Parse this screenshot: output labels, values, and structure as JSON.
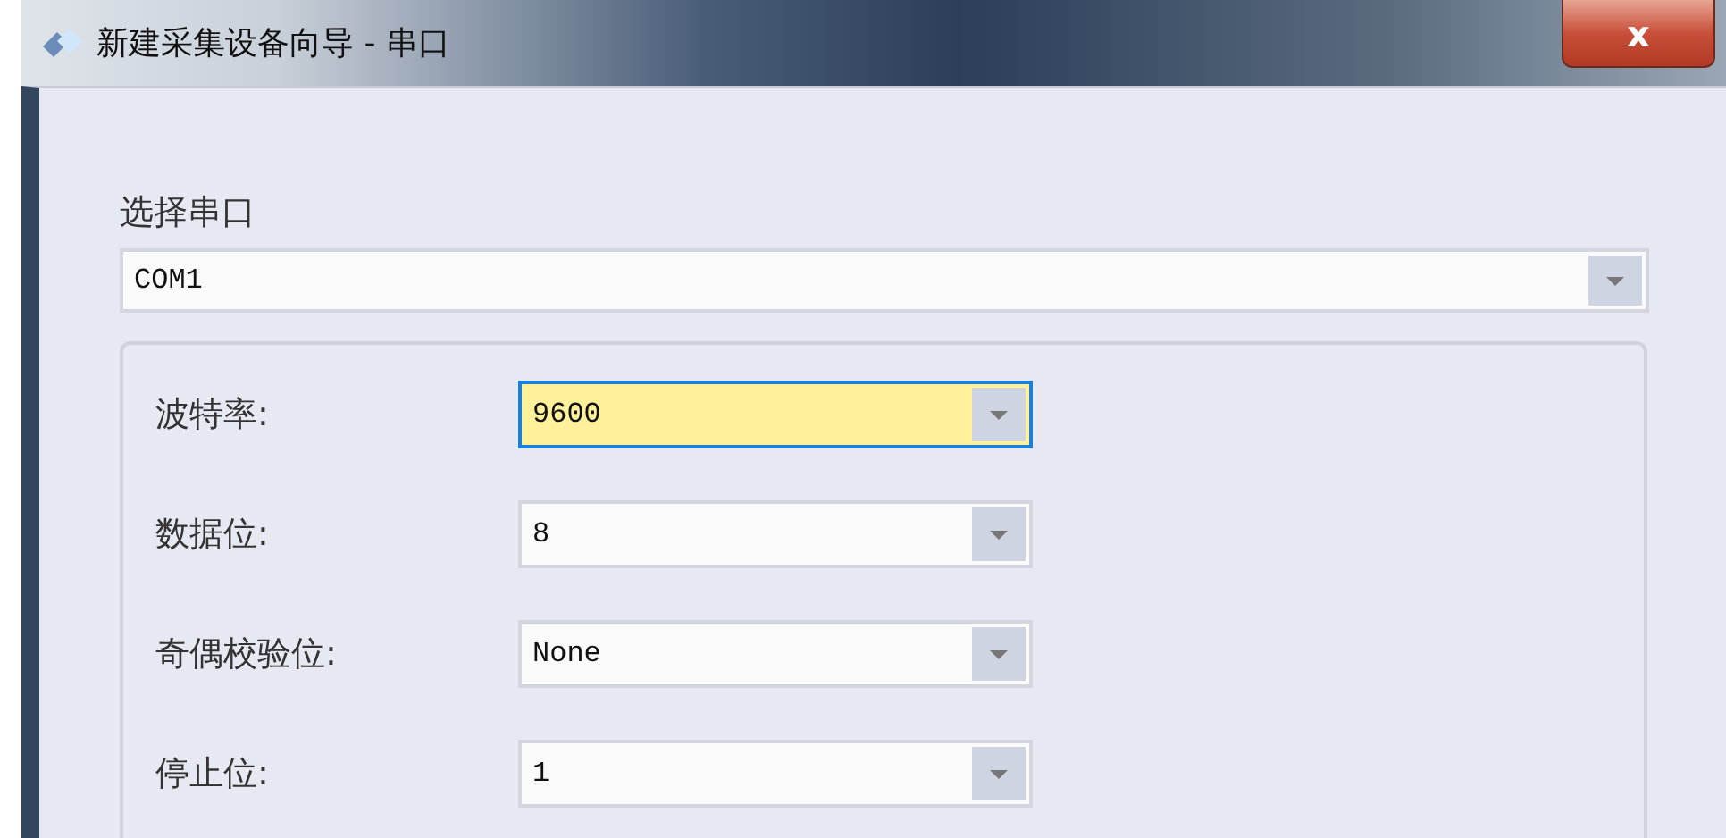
{
  "window": {
    "title": "新建采集设备向导 - 串口",
    "close": "x"
  },
  "port": {
    "label": "选择串口",
    "value": "COM1"
  },
  "settings": [
    {
      "label": "波特率:",
      "value": "9600",
      "focused": true
    },
    {
      "label": "数据位:",
      "value": "8",
      "focused": false
    },
    {
      "label": "奇偶校验位:",
      "value": "None",
      "focused": false
    },
    {
      "label": "停止位:",
      "value": "1",
      "focused": false
    }
  ]
}
